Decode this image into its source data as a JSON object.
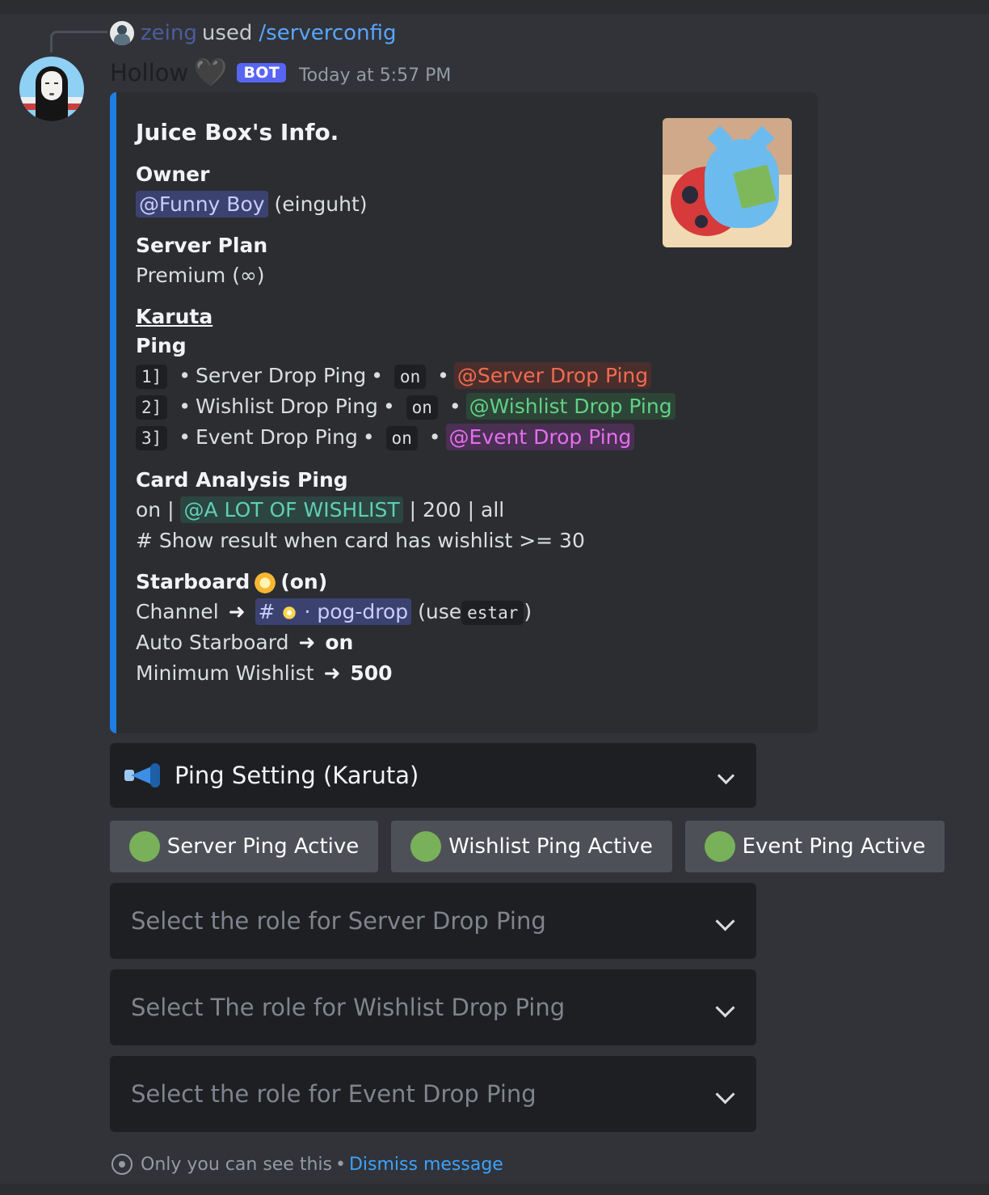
{
  "reply": {
    "username": "zeing",
    "used": "used",
    "command": "/serverconfig"
  },
  "message": {
    "author": "Hollow",
    "author_emoji": "🖤",
    "bot_tag": "BOT",
    "timestamp": "Today at 5:57 PM"
  },
  "embed": {
    "accent_color": "#1e7ee6",
    "title": "Juice Box's Info.",
    "owner_label": "Owner",
    "owner_mention": "@Funny Boy",
    "owner_handle": "(einguht)",
    "plan_label": "Server Plan",
    "plan_value": "Premium (∞)",
    "section_label": "Karuta",
    "ping_label": "Ping",
    "pings": [
      {
        "index": "1]",
        "name": "Server Drop Ping",
        "state": "on",
        "role": "@Server Drop Ping"
      },
      {
        "index": "2]",
        "name": "Wishlist Drop Ping",
        "state": "on",
        "role": "@Wishlist Drop Ping"
      },
      {
        "index": "3]",
        "name": "Event Drop Ping",
        "state": "on",
        "role": "@Event Drop Ping"
      }
    ],
    "card_analysis_label": "Card Analysis Ping",
    "card_analysis": {
      "state": "on",
      "role": "@A LOT OF WISHLIST",
      "rest": "| 200 | all",
      "note": "# Show result when card has wishlist >= 30"
    },
    "starboard": {
      "label": "Starboard",
      "status": "(on)",
      "channel_label": "Channel",
      "channel_hash": "#",
      "channel_name": "· pog-drop",
      "use_prefix": "(use",
      "use_cmd": "estar",
      "use_suffix": ")",
      "auto_label": "Auto Starboard",
      "auto_value": "on",
      "min_label": "Minimum Wishlist",
      "min_value": "500"
    }
  },
  "components": {
    "ping_setting_select": "Ping Setting (Karuta)",
    "buttons": [
      {
        "label": "Server Ping Active"
      },
      {
        "label": "Wishlist Ping Active"
      },
      {
        "label": "Event Ping Active"
      }
    ],
    "role_selects": [
      {
        "placeholder": "Select the role for Server Drop Ping"
      },
      {
        "placeholder": "Select The role for Wishlist Drop Ping"
      },
      {
        "placeholder": "Select the role for Event Drop Ping"
      }
    ]
  },
  "footer": {
    "note": "Only you can see this",
    "dot": "•",
    "dismiss": "Dismiss message"
  },
  "icons": {
    "arrow": "➜",
    "bullet": "•"
  }
}
